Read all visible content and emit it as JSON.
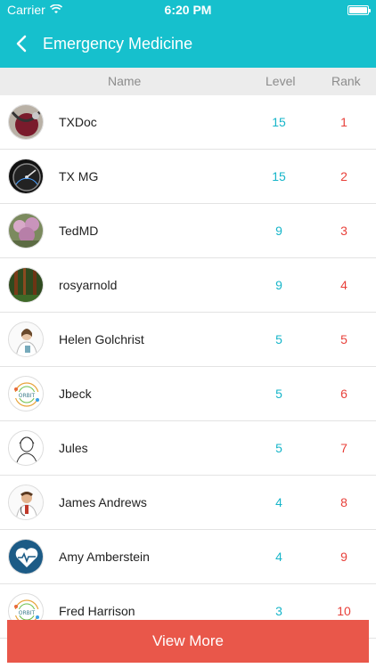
{
  "status_bar": {
    "carrier": "Carrier",
    "time": "6:20 PM"
  },
  "nav": {
    "title": "Emergency Medicine"
  },
  "table": {
    "headers": {
      "name": "Name",
      "level": "Level",
      "rank": "Rank"
    },
    "rows": [
      {
        "name": "TXDoc",
        "level": "15",
        "rank": "1",
        "avatar": "stethoscope-photo"
      },
      {
        "name": "TX MG",
        "level": "15",
        "rank": "2",
        "avatar": "speedometer-photo"
      },
      {
        "name": "TedMD",
        "level": "9",
        "rank": "3",
        "avatar": "flower-tree-photo"
      },
      {
        "name": "rosyarnold",
        "level": "9",
        "rank": "4",
        "avatar": "forest-photo"
      },
      {
        "name": "Helen Golchrist",
        "level": "5",
        "rank": "5",
        "avatar": "female-doctor-photo"
      },
      {
        "name": "Jbeck",
        "level": "5",
        "rank": "6",
        "avatar": "orbit-logo"
      },
      {
        "name": "Jules",
        "level": "5",
        "rank": "7",
        "avatar": "woman-sketch"
      },
      {
        "name": "James Andrews",
        "level": "4",
        "rank": "8",
        "avatar": "male-doctor-photo"
      },
      {
        "name": "Amy Amberstein",
        "level": "4",
        "rank": "9",
        "avatar": "heart-pulse-icon"
      },
      {
        "name": "Fred Harrison",
        "level": "3",
        "rank": "10",
        "avatar": "orbit-logo"
      }
    ]
  },
  "footer": {
    "view_more_label": "View More"
  },
  "colors": {
    "accent": "#16c0cd",
    "level": "#16b5c9",
    "rank": "#e8403a",
    "button": "#e9574a"
  }
}
